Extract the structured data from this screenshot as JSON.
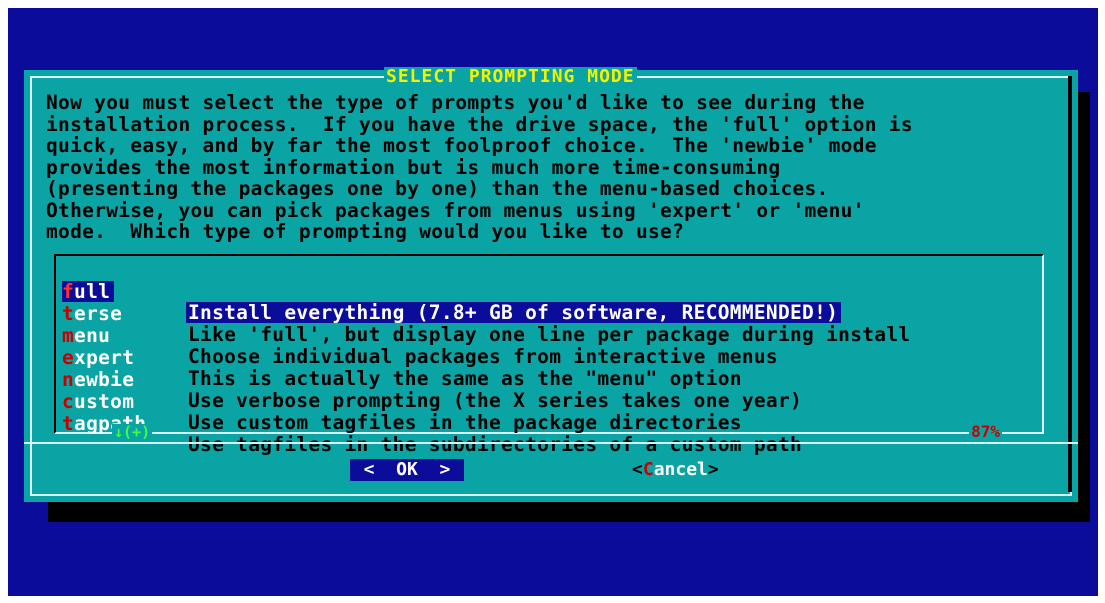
{
  "dialog": {
    "title": "SELECT PROMPTING MODE",
    "description": "Now you must select the type of prompts you'd like to see during the\ninstallation process.  If you have the drive space, the 'full' option is\nquick, easy, and by far the most foolproof choice.  The 'newbie' mode\nprovides the most information but is much more time-consuming\n(presenting the packages one by one) than the menu-based choices.\nOtherwise, you can pick packages from menus using 'expert' or 'menu'\nmode.  Which type of prompting would you like to use?"
  },
  "menu": {
    "items": [
      {
        "hotkey": "f",
        "tag_rest": "ull",
        "label": "Install everything (7.8+ GB of software, RECOMMENDED!)",
        "selected": true
      },
      {
        "hotkey": "t",
        "tag_rest": "erse",
        "label": "Like 'full', but display one line per package during install"
      },
      {
        "hotkey": "m",
        "tag_rest": "enu",
        "label": "Choose individual packages from interactive menus"
      },
      {
        "hotkey": "e",
        "tag_rest": "xpert",
        "label": "This is actually the same as the \"menu\" option"
      },
      {
        "hotkey": "n",
        "tag_rest": "ewbie",
        "label": "Use verbose prompting (the X series takes one year)"
      },
      {
        "hotkey": "c",
        "tag_rest": "ustom",
        "label": "Use custom tagfiles in the package directories"
      },
      {
        "hotkey": "t",
        "tag_rest": "agpath",
        "label": "Use tagfiles in the subdirectories of a custom path"
      }
    ],
    "more_indicator": "↓(+)",
    "scroll_percent": "87%"
  },
  "buttons": {
    "ok": "<  OK  >",
    "cancel_open": "<",
    "cancel_hotkey": "C",
    "cancel_rest": "ancel",
    "cancel_close": ">"
  },
  "colors": {
    "screen_bg": "#0c0c9a",
    "dialog_bg": "#0aa4a4",
    "title_fg": "#f2f200",
    "hotkey_fg": "#c80000",
    "selection_bg": "#0c0c9a"
  }
}
